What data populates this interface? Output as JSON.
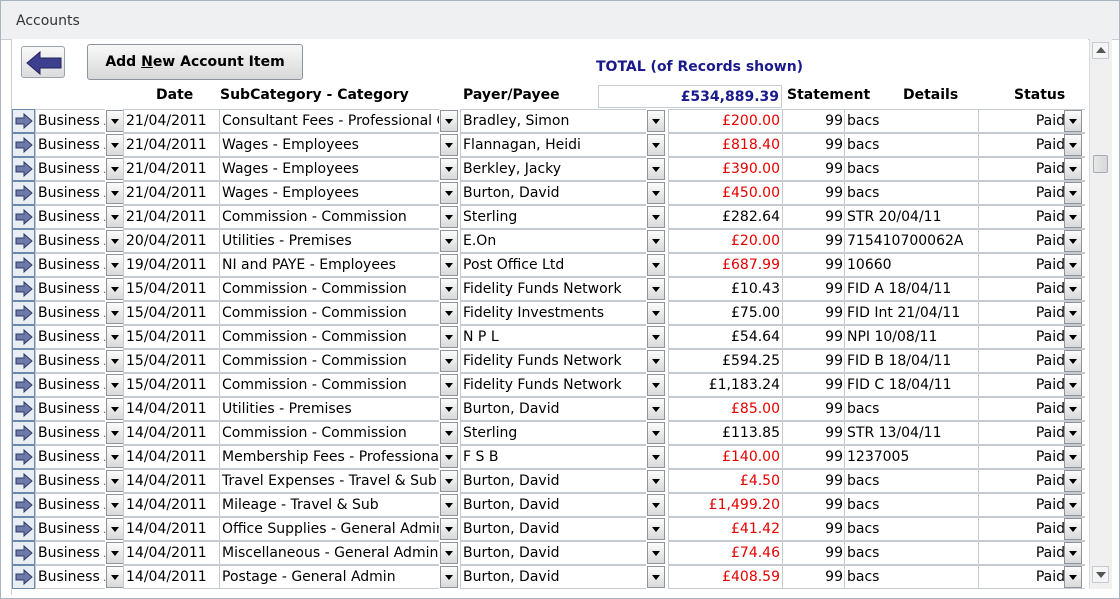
{
  "window": {
    "title": "Accounts"
  },
  "toolbar": {
    "add_prefix": "Add ",
    "add_accel": "N",
    "add_suffix": "ew Account Item"
  },
  "summary": {
    "label": "TOTAL (of Records shown)",
    "value": "£534,889.39"
  },
  "columns": {
    "date": "Date",
    "subcategory": "SubCategory - Category",
    "payee": "Payer/Payee",
    "statement": "Statement",
    "details": "Details",
    "status": "Status"
  },
  "colors": {
    "negative": "#e60000",
    "total": "#1a1a8c"
  },
  "rows": [
    {
      "type": "Business Account",
      "date": "21/04/2011",
      "subcat": "Consultant Fees - Professional Charges",
      "payee": "Bradley, Simon",
      "amount": "£200.00",
      "negative": true,
      "statement": "99",
      "details": "bacs",
      "status": "Paid"
    },
    {
      "type": "Business Account",
      "date": "21/04/2011",
      "subcat": "Wages - Employees",
      "payee": "Flannagan, Heidi",
      "amount": "£818.40",
      "negative": true,
      "statement": "99",
      "details": "bacs",
      "status": "Paid"
    },
    {
      "type": "Business Account",
      "date": "21/04/2011",
      "subcat": "Wages - Employees",
      "payee": "Berkley, Jacky",
      "amount": "£390.00",
      "negative": true,
      "statement": "99",
      "details": "bacs",
      "status": "Paid"
    },
    {
      "type": "Business Account",
      "date": "21/04/2011",
      "subcat": "Wages - Employees",
      "payee": "Burton, David",
      "amount": "£450.00",
      "negative": true,
      "statement": "99",
      "details": "bacs",
      "status": "Paid"
    },
    {
      "type": "Business Account",
      "date": "21/04/2011",
      "subcat": "Commission - Commission",
      "payee": "Sterling",
      "amount": "£282.64",
      "negative": false,
      "statement": "99",
      "details": "STR 20/04/11",
      "status": "Paid"
    },
    {
      "type": "Business Account",
      "date": "20/04/2011",
      "subcat": "Utilities - Premises",
      "payee": "E.On",
      "amount": "£20.00",
      "negative": true,
      "statement": "99",
      "details": "715410700062A",
      "status": "Paid"
    },
    {
      "type": "Business Account",
      "date": "19/04/2011",
      "subcat": "NI and PAYE - Employees",
      "payee": "Post Office Ltd",
      "amount": "£687.99",
      "negative": true,
      "statement": "99",
      "details": "10660",
      "status": "Paid"
    },
    {
      "type": "Business Account",
      "date": "15/04/2011",
      "subcat": "Commission - Commission",
      "payee": "Fidelity Funds Network",
      "amount": "£10.43",
      "negative": false,
      "statement": "99",
      "details": "FID A 18/04/11",
      "status": "Paid"
    },
    {
      "type": "Business Account",
      "date": "15/04/2011",
      "subcat": "Commission - Commission",
      "payee": "Fidelity Investments",
      "amount": "£75.00",
      "negative": false,
      "statement": "99",
      "details": "FID Int 21/04/11",
      "status": "Paid"
    },
    {
      "type": "Business Account",
      "date": "15/04/2011",
      "subcat": "Commission - Commission",
      "payee": "N P L",
      "amount": "£54.64",
      "negative": false,
      "statement": "99",
      "details": "NPI 10/08/11",
      "status": "Paid"
    },
    {
      "type": "Business Account",
      "date": "15/04/2011",
      "subcat": "Commission - Commission",
      "payee": "Fidelity Funds Network",
      "amount": "£594.25",
      "negative": false,
      "statement": "99",
      "details": "FID B 18/04/11",
      "status": "Paid"
    },
    {
      "type": "Business Account",
      "date": "15/04/2011",
      "subcat": "Commission - Commission",
      "payee": "Fidelity Funds Network",
      "amount": "£1,183.24",
      "negative": false,
      "statement": "99",
      "details": "FID C 18/04/11",
      "status": "Paid"
    },
    {
      "type": "Business Account",
      "date": "14/04/2011",
      "subcat": "Utilities - Premises",
      "payee": "Burton, David",
      "amount": "£85.00",
      "negative": true,
      "statement": "99",
      "details": "bacs",
      "status": "Paid"
    },
    {
      "type": "Business Account",
      "date": "14/04/2011",
      "subcat": "Commission - Commission",
      "payee": "Sterling",
      "amount": "£113.85",
      "negative": false,
      "statement": "99",
      "details": "STR 13/04/11",
      "status": "Paid"
    },
    {
      "type": "Business Account",
      "date": "14/04/2011",
      "subcat": "Membership Fees - Professional",
      "payee": "F S B",
      "amount": "£140.00",
      "negative": true,
      "statement": "99",
      "details": "1237005",
      "status": "Paid"
    },
    {
      "type": "Business Account",
      "date": "14/04/2011",
      "subcat": "Travel Expenses - Travel & Sub",
      "payee": "Burton, David",
      "amount": "£4.50",
      "negative": true,
      "statement": "99",
      "details": "bacs",
      "status": "Paid"
    },
    {
      "type": "Business Account",
      "date": "14/04/2011",
      "subcat": "Mileage - Travel & Sub",
      "payee": "Burton, David",
      "amount": "£1,499.20",
      "negative": true,
      "statement": "99",
      "details": "bacs",
      "status": "Paid"
    },
    {
      "type": "Business Account",
      "date": "14/04/2011",
      "subcat": "Office Supplies - General Admin",
      "payee": "Burton, David",
      "amount": "£41.42",
      "negative": true,
      "statement": "99",
      "details": "bacs",
      "status": "Paid"
    },
    {
      "type": "Business Account",
      "date": "14/04/2011",
      "subcat": "Miscellaneous - General Admin",
      "payee": "Burton, David",
      "amount": "£74.46",
      "negative": true,
      "statement": "99",
      "details": "bacs",
      "status": "Paid"
    },
    {
      "type": "Business Account",
      "date": "14/04/2011",
      "subcat": "Postage - General Admin",
      "payee": "Burton, David",
      "amount": "£408.59",
      "negative": true,
      "statement": "99",
      "details": "bacs",
      "status": "Paid"
    }
  ]
}
